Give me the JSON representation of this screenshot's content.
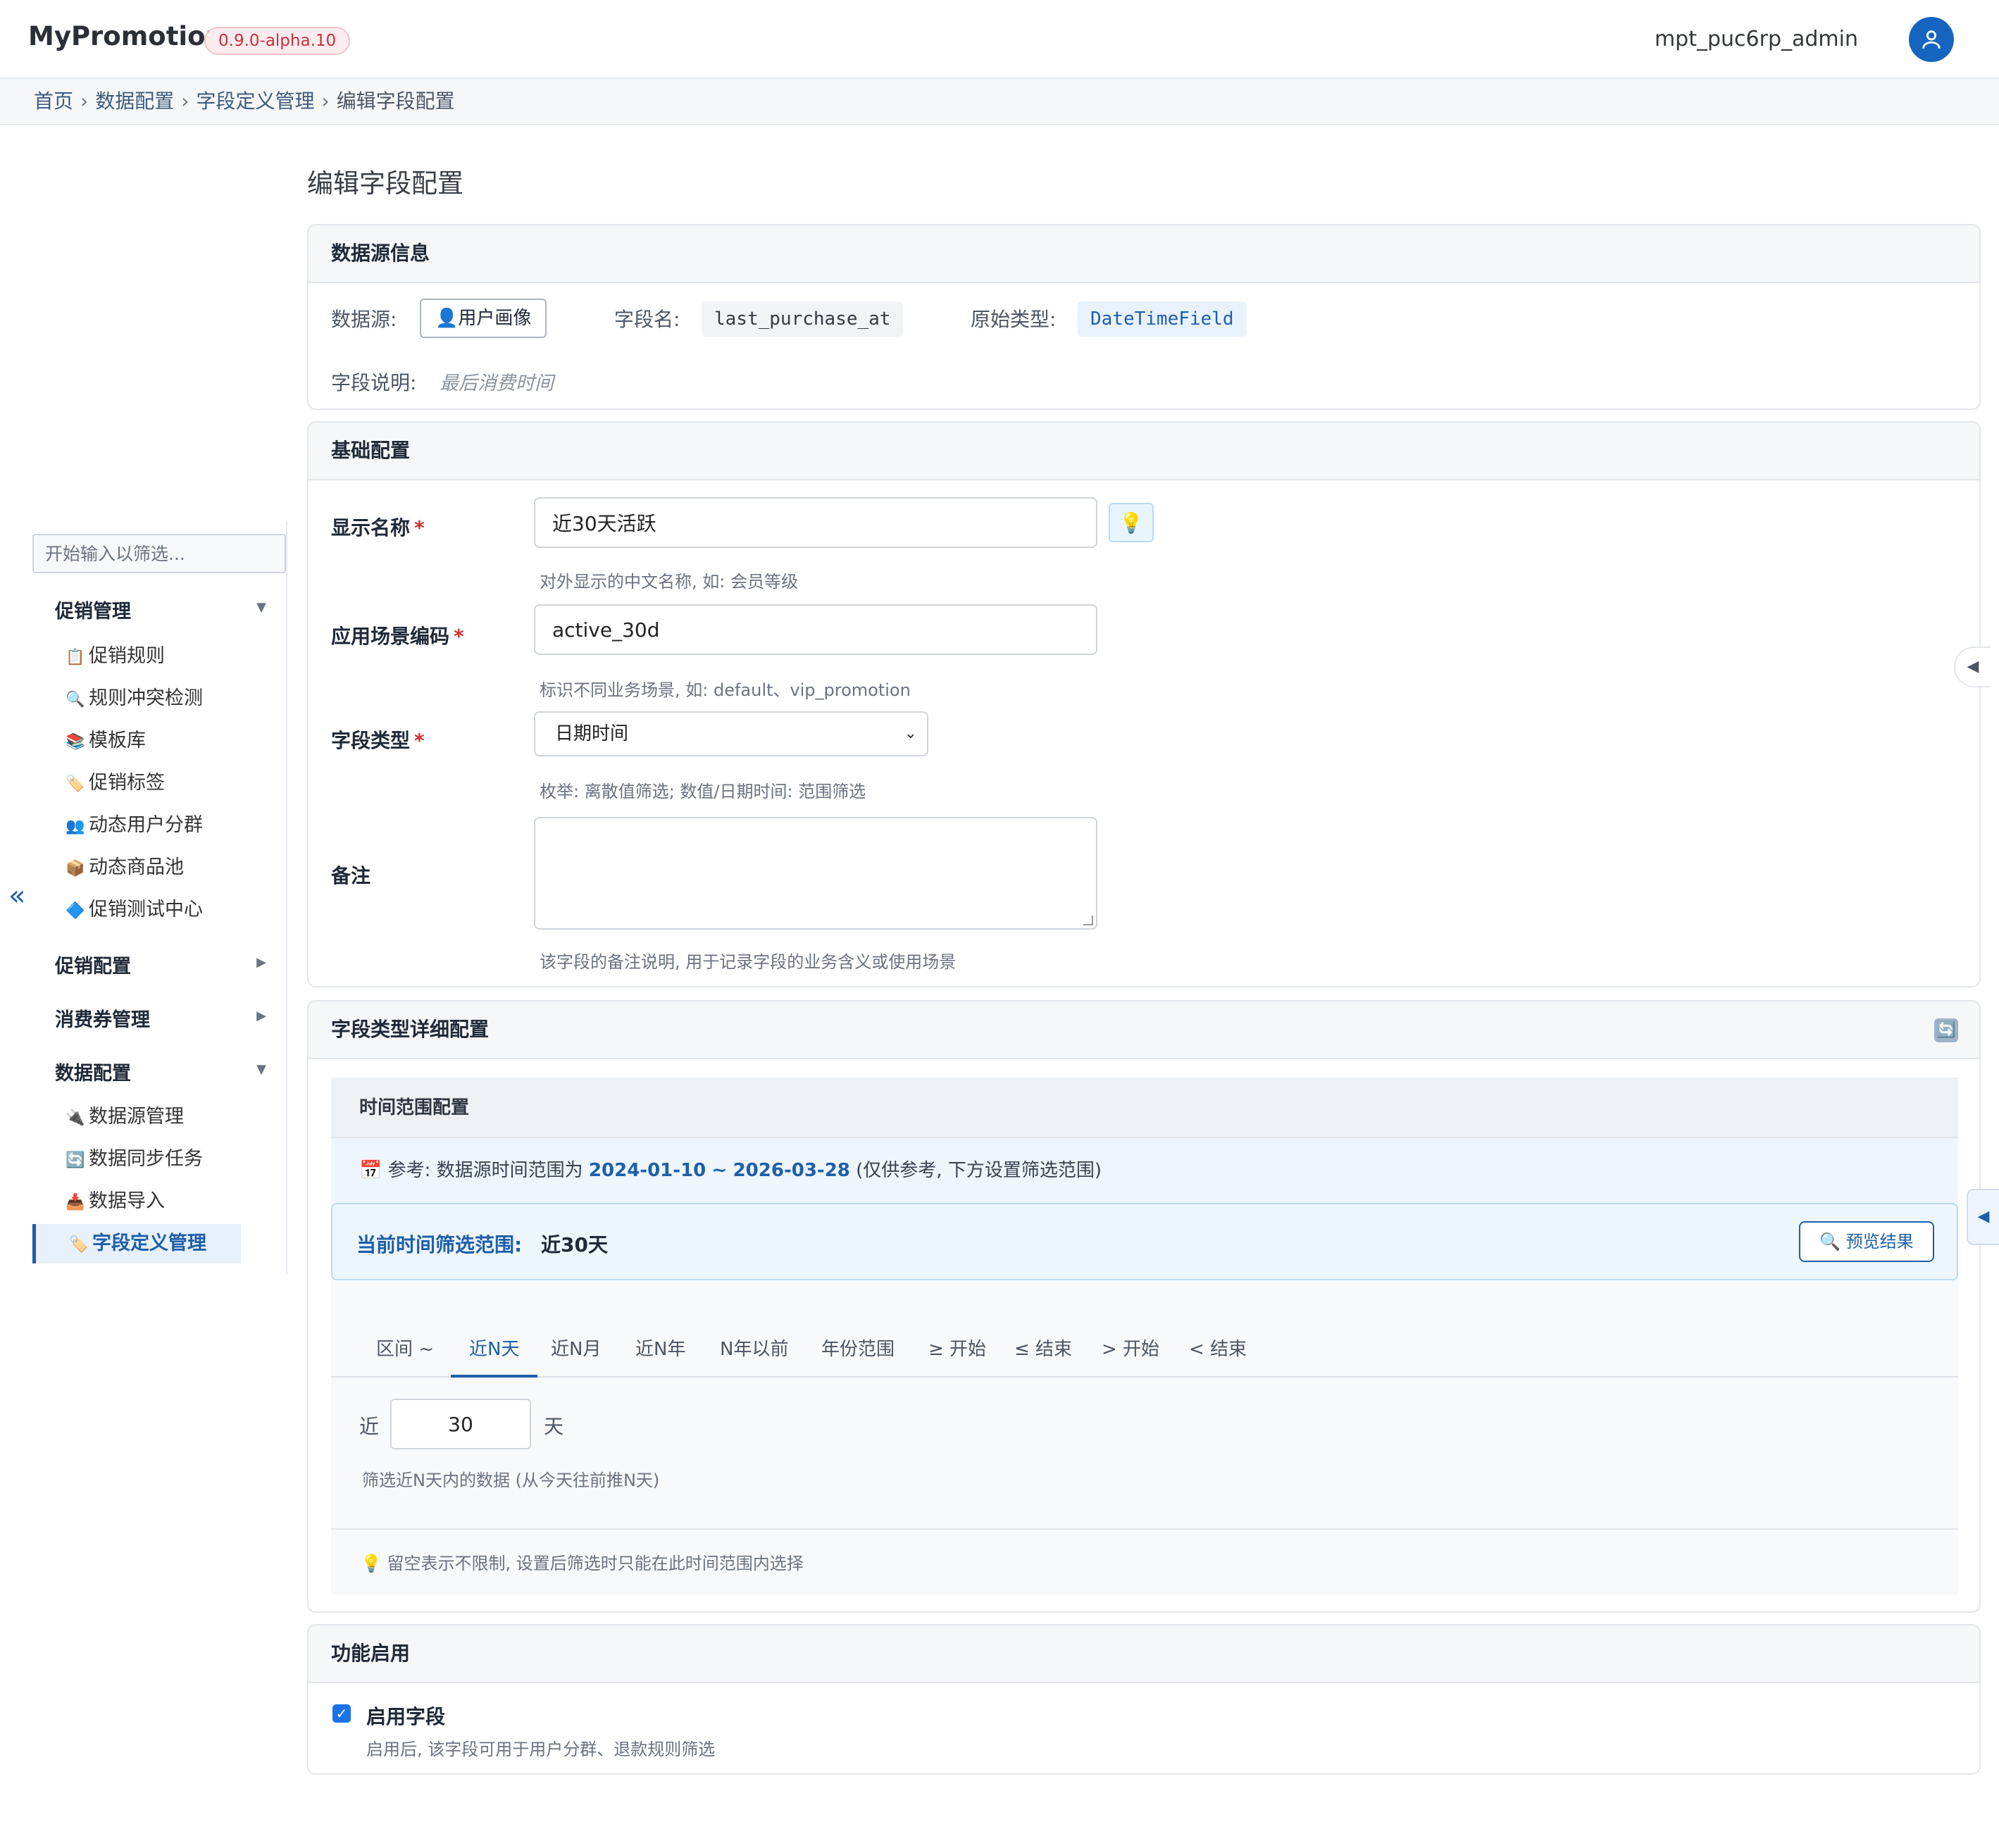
{
  "header": {
    "brand": "MyPromotion",
    "version": "0.9.0-alpha.10",
    "username": "mpt_puc6rp_admin",
    "avatar_icon": "user-icon"
  },
  "breadcrumb": [
    "首页",
    "数据配置",
    "字段定义管理",
    "编辑字段配置"
  ],
  "breadcrumb_sep": "›",
  "sidebar": {
    "filter_placeholder": "开始输入以筛选...",
    "collapse_symbol": "«",
    "groups": [
      {
        "label": "促销管理",
        "expanded": true,
        "items": [
          {
            "icon": "📋",
            "label": "促销规则"
          },
          {
            "icon": "🔍",
            "label": "规则冲突检测"
          },
          {
            "icon": "📚",
            "label": "模板库"
          },
          {
            "icon": "🏷️",
            "label": "促销标签"
          },
          {
            "icon": "👥",
            "label": "动态用户分群"
          },
          {
            "icon": "📦",
            "label": "动态商品池"
          },
          {
            "icon": "🔷",
            "label": "促销测试中心"
          }
        ]
      },
      {
        "label": "促销配置",
        "expanded": false,
        "items": []
      },
      {
        "label": "消费券管理",
        "expanded": false,
        "items": []
      },
      {
        "label": "数据配置",
        "expanded": true,
        "items": [
          {
            "icon": "🔌",
            "label": "数据源管理"
          },
          {
            "icon": "🔄",
            "label": "数据同步任务"
          },
          {
            "icon": "📥",
            "label": "数据导入"
          },
          {
            "icon": "🏷️",
            "label": "字段定义管理",
            "active": true
          }
        ]
      }
    ]
  },
  "page": {
    "title": "编辑字段配置"
  },
  "datasource_card": {
    "title": "数据源信息",
    "datasource_label": "数据源:",
    "datasource_value": "👤用户画像",
    "field_name_label": "字段名:",
    "field_name_value": "last_purchase_at",
    "raw_type_label": "原始类型:",
    "raw_type_value": "DateTimeField",
    "desc_label": "字段说明:",
    "desc_value": "最后消费时间"
  },
  "basic_card": {
    "title": "基础配置",
    "display_name_label": "显示名称",
    "display_name_value": "近30天活跃",
    "display_name_help": "对外显示的中文名称, 如: 会员等级",
    "hint_icon": "💡",
    "scene_code_label": "应用场景编码",
    "scene_code_value": "active_30d",
    "scene_code_help": "标识不同业务场景, 如: default、vip_promotion",
    "field_type_label": "字段类型",
    "field_type_value": "日期时间",
    "field_type_help": "枚举: 离散值筛选; 数值/日期时间: 范围筛选",
    "remark_label": "备注",
    "remark_value": "",
    "remark_help": "该字段的备注说明, 用于记录字段的业务含义或使用场景",
    "required_mark": "*"
  },
  "type_detail_card": {
    "title": "字段类型详细配置",
    "refresh_icon": "🔄",
    "time_range_title": "时间范围配置",
    "ref_icon": "📅",
    "ref_prefix": "参考: 数据源时间范围为",
    "ref_start": "2024-01-10",
    "ref_tilde": "~",
    "ref_end": "2026-03-28",
    "ref_suffix": "(仅供参考, 下方设置筛选范围)",
    "current_range_label": "当前时间筛选范围:",
    "current_range_value": "近30天",
    "preview_button": "🔍 预览结果",
    "tabs": [
      {
        "label": "区间 ~",
        "active": false
      },
      {
        "label": "近N天",
        "active": true
      },
      {
        "label": "近N月",
        "active": false
      },
      {
        "label": "近N年",
        "active": false
      },
      {
        "label": "N年以前",
        "active": false
      },
      {
        "label": "年份范围",
        "active": false
      },
      {
        "label": "≥ 开始",
        "active": false
      },
      {
        "label": "≤ 结束",
        "active": false
      },
      {
        "label": "> 开始",
        "active": false
      },
      {
        "label": "< 结束",
        "active": false
      }
    ],
    "days_prefix": "近",
    "days_value": "30",
    "days_suffix": "天",
    "days_help": "筛选近N天内的数据 (从今天往前推N天)",
    "tip_icon": "💡",
    "tip_text": "留空表示不限制, 设置后筛选时只能在此时间范围内选择"
  },
  "feature_card": {
    "title": "功能启用",
    "enable_label": "启用字段",
    "enable_checked": true,
    "enable_help": "启用后, 该字段可用于用户分群、退款规则筛选"
  },
  "colors": {
    "accent": "#1e5fa8",
    "danger": "#d63031",
    "badge_bg": "#fdecee"
  }
}
